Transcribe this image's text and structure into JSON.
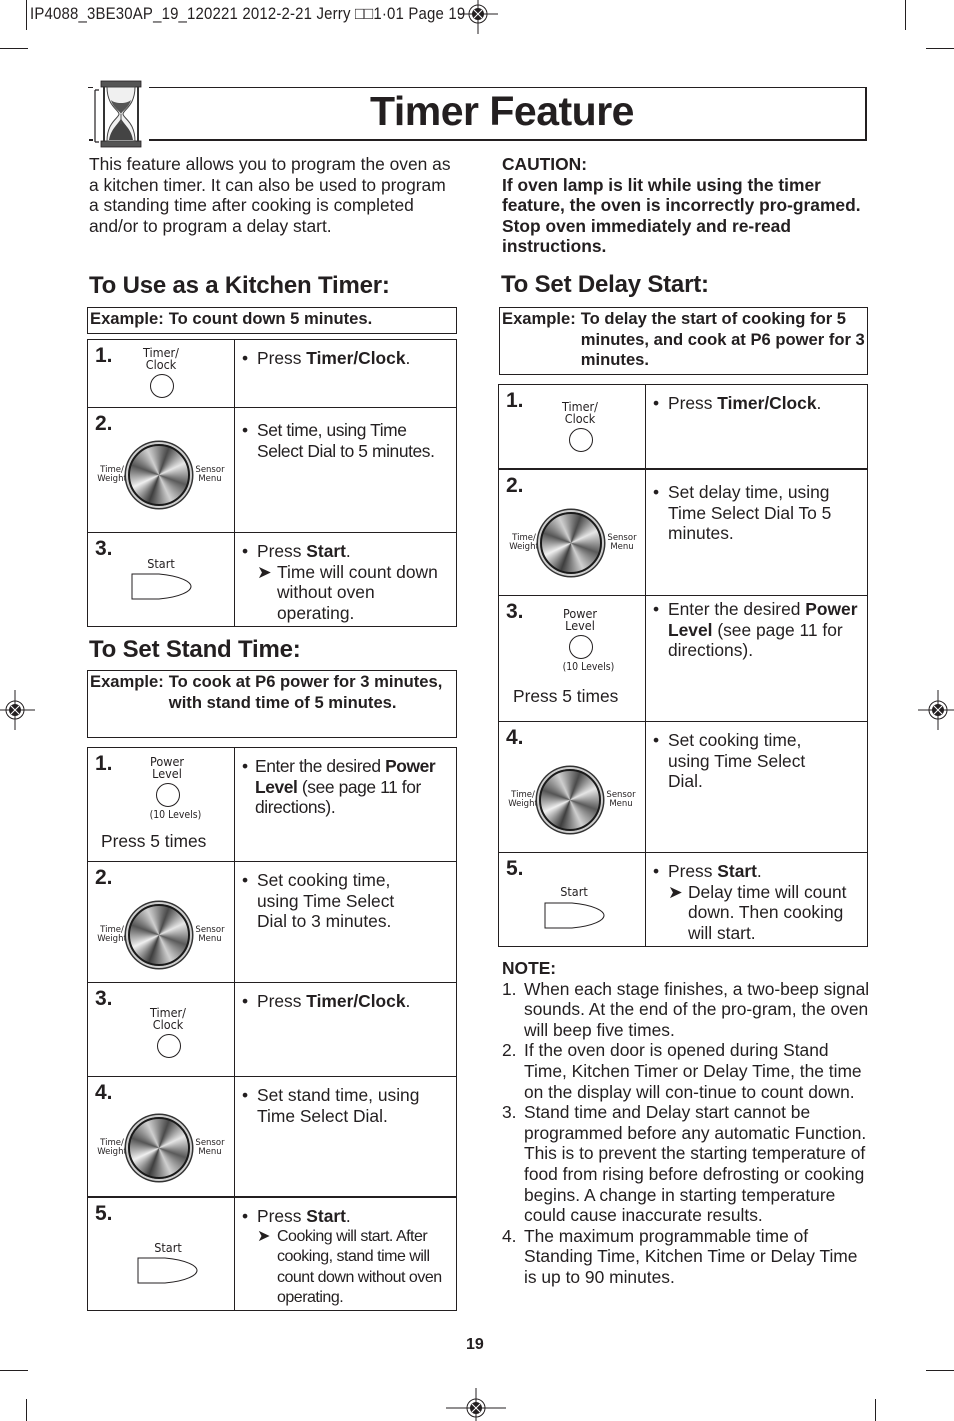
{
  "slug": "IP4088_3BE30AP_19_120221  2012-2-21  Jerry □□1·01  Page 19",
  "title": "Timer Feature",
  "icons": {
    "banner": "hourglass-icon",
    "registration": "registration-crosshair-icon",
    "button": "circle-button-icon",
    "dial": "time-select-dial-icon",
    "start": "start-button-icon",
    "arrow": "➤"
  },
  "intro": "This feature allows you to program the oven as a kitchen timer. It can also be used to program a standing time after cooking is completed and/or to program a delay start.",
  "caution": {
    "heading": "CAUTION:",
    "text": "If oven lamp is lit while using the timer feature, the oven is incorrectly pro-gramed. Stop oven immediately and re-read instructions."
  },
  "button_labels": {
    "timer_clock_1": "Timer/",
    "timer_clock_2": "Clock",
    "power_level_1": "Power",
    "power_level_2": "Level",
    "levels": "(10 Levels)",
    "start": "Start",
    "dial_left_1": "Time/",
    "dial_left_2": "Weight",
    "dial_right_1": "Sensor",
    "dial_right_2": "Menu",
    "press_5_times": "Press 5 times"
  },
  "kitchen_timer": {
    "heading": "To Use  as a Kitchen Timer:",
    "example_label": "Example:",
    "example_text": "To count down 5 minutes.",
    "steps": [
      {
        "num": "1.",
        "pre": "Press ",
        "bold": "Timer/Clock",
        "post": "."
      },
      {
        "num": "2.",
        "text": "Set time, using Time Select Dial to 5 minutes."
      },
      {
        "num": "3.",
        "pre": "Press ",
        "bold": "Start",
        "post": ".",
        "sub": "Time will count down without oven operating."
      }
    ]
  },
  "stand_time": {
    "heading": "To Set Stand Time:",
    "example_label": "Example:",
    "example_text": "To cook at P6 power for 3 minutes, with stand time of 5 minutes.",
    "steps": [
      {
        "num": "1.",
        "pre": "Enter the desired ",
        "bold": "Power Level",
        "post": " (see page 11 for directions)."
      },
      {
        "num": "2.",
        "text": "Set cooking time, using Time Select Dial to 3 minutes."
      },
      {
        "num": "3.",
        "pre": "Press ",
        "bold": "Timer/Clock",
        "post": "."
      },
      {
        "num": "4.",
        "text": "Set stand time, using Time Select Dial."
      },
      {
        "num": "5.",
        "pre": "Press ",
        "bold": "Start",
        "post": ".",
        "sub": "Cooking will start. After cooking, stand time will count down without oven operating."
      }
    ]
  },
  "delay_start": {
    "heading": "To Set Delay Start:",
    "example_label": "Example:",
    "example_text": "To delay the start of cooking for 5 minutes, and cook at P6 power for 3 minutes.",
    "steps": [
      {
        "num": "1.",
        "pre": "Press ",
        "bold": "Timer/Clock",
        "post": "."
      },
      {
        "num": "2.",
        "text": "Set delay time, using Time Select Dial To 5 minutes."
      },
      {
        "num": "3.",
        "pre": "Enter the desired ",
        "bold": "Power Level",
        "post": " (see page 11 for directions)."
      },
      {
        "num": "4.",
        "text": "Set cooking time, using Time Select Dial."
      },
      {
        "num": "5.",
        "pre": "Press ",
        "bold": "Start",
        "post": ".",
        "sub": "Delay time will count down. Then cooking will start."
      }
    ]
  },
  "note": {
    "heading": "NOTE:",
    "items": [
      {
        "n": "1.",
        "text": "When each stage finishes, a two-beep signal sounds. At the end of the pro-gram, the oven will beep five times."
      },
      {
        "n": "2.",
        "text": "If the oven door is opened during Stand Time, Kitchen Timer or Delay Time, the time on the display will con-tinue to count down."
      },
      {
        "n": "3.",
        "text": "Stand time and Delay start cannot be programmed before any automatic Function. This is to prevent the starting temperature of food from rising before defrosting or cooking begins. A change in starting temperature could cause inaccurate results."
      },
      {
        "n": "4.",
        "text": "The maximum programmable time of Standing Time, Kitchen Time or Delay Time is up to 90 minutes."
      }
    ]
  },
  "page_number": "19"
}
